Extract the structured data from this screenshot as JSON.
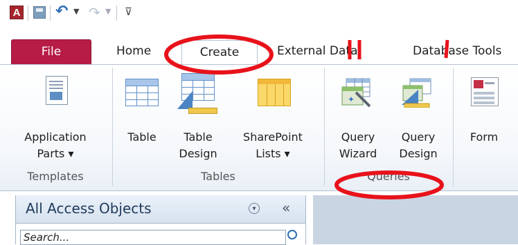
{
  "app": {
    "icon_letter": "A"
  },
  "quick_access": {
    "undo_icon": "undo-icon",
    "redo_icon": "redo-icon",
    "save_icon": "save-icon"
  },
  "tabs": {
    "file": "File",
    "home": "Home",
    "create": "Create",
    "external_data": "External Data",
    "database_tools": "Database Tools"
  },
  "ribbon": {
    "templates": {
      "label": "Templates",
      "application_parts": {
        "line1": "Application",
        "line2": "Parts ▾"
      }
    },
    "tables": {
      "label": "Tables",
      "table": {
        "line1": "Table"
      },
      "table_design": {
        "line1": "Table",
        "line2": "Design"
      },
      "sharepoint_lists": {
        "line1": "SharePoint",
        "line2": "Lists ▾"
      }
    },
    "queries": {
      "label": "Queries",
      "query_wizard": {
        "line1": "Query",
        "line2": "Wizard"
      },
      "query_design": {
        "line1": "Query",
        "line2": "Design"
      }
    },
    "forms": {
      "form": {
        "line1": "Form"
      }
    }
  },
  "nav_pane": {
    "title": "All Access Objects",
    "collapse_glyph": "«",
    "dropdown_glyph": "▾",
    "search_placeholder": "Search..."
  },
  "annotation_colors": {
    "circle": "#e8121b"
  }
}
